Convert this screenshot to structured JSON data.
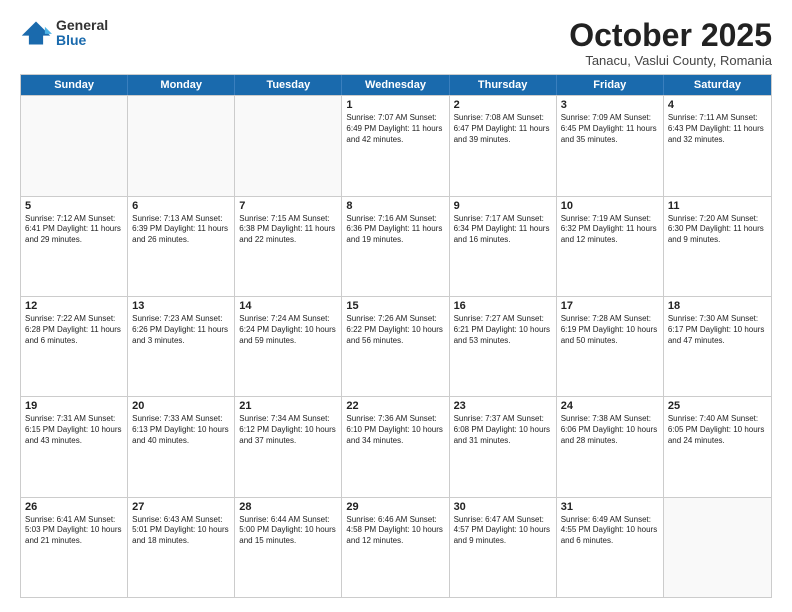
{
  "logo": {
    "general": "General",
    "blue": "Blue"
  },
  "title": "October 2025",
  "subtitle": "Tanacu, Vaslui County, Romania",
  "header_days": [
    "Sunday",
    "Monday",
    "Tuesday",
    "Wednesday",
    "Thursday",
    "Friday",
    "Saturday"
  ],
  "weeks": [
    [
      {
        "day": "",
        "info": "",
        "empty": true
      },
      {
        "day": "",
        "info": "",
        "empty": true
      },
      {
        "day": "",
        "info": "",
        "empty": true
      },
      {
        "day": "1",
        "info": "Sunrise: 7:07 AM\nSunset: 6:49 PM\nDaylight: 11 hours\nand 42 minutes."
      },
      {
        "day": "2",
        "info": "Sunrise: 7:08 AM\nSunset: 6:47 PM\nDaylight: 11 hours\nand 39 minutes."
      },
      {
        "day": "3",
        "info": "Sunrise: 7:09 AM\nSunset: 6:45 PM\nDaylight: 11 hours\nand 35 minutes."
      },
      {
        "day": "4",
        "info": "Sunrise: 7:11 AM\nSunset: 6:43 PM\nDaylight: 11 hours\nand 32 minutes."
      }
    ],
    [
      {
        "day": "5",
        "info": "Sunrise: 7:12 AM\nSunset: 6:41 PM\nDaylight: 11 hours\nand 29 minutes."
      },
      {
        "day": "6",
        "info": "Sunrise: 7:13 AM\nSunset: 6:39 PM\nDaylight: 11 hours\nand 26 minutes."
      },
      {
        "day": "7",
        "info": "Sunrise: 7:15 AM\nSunset: 6:38 PM\nDaylight: 11 hours\nand 22 minutes."
      },
      {
        "day": "8",
        "info": "Sunrise: 7:16 AM\nSunset: 6:36 PM\nDaylight: 11 hours\nand 19 minutes."
      },
      {
        "day": "9",
        "info": "Sunrise: 7:17 AM\nSunset: 6:34 PM\nDaylight: 11 hours\nand 16 minutes."
      },
      {
        "day": "10",
        "info": "Sunrise: 7:19 AM\nSunset: 6:32 PM\nDaylight: 11 hours\nand 12 minutes."
      },
      {
        "day": "11",
        "info": "Sunrise: 7:20 AM\nSunset: 6:30 PM\nDaylight: 11 hours\nand 9 minutes."
      }
    ],
    [
      {
        "day": "12",
        "info": "Sunrise: 7:22 AM\nSunset: 6:28 PM\nDaylight: 11 hours\nand 6 minutes."
      },
      {
        "day": "13",
        "info": "Sunrise: 7:23 AM\nSunset: 6:26 PM\nDaylight: 11 hours\nand 3 minutes."
      },
      {
        "day": "14",
        "info": "Sunrise: 7:24 AM\nSunset: 6:24 PM\nDaylight: 10 hours\nand 59 minutes."
      },
      {
        "day": "15",
        "info": "Sunrise: 7:26 AM\nSunset: 6:22 PM\nDaylight: 10 hours\nand 56 minutes."
      },
      {
        "day": "16",
        "info": "Sunrise: 7:27 AM\nSunset: 6:21 PM\nDaylight: 10 hours\nand 53 minutes."
      },
      {
        "day": "17",
        "info": "Sunrise: 7:28 AM\nSunset: 6:19 PM\nDaylight: 10 hours\nand 50 minutes."
      },
      {
        "day": "18",
        "info": "Sunrise: 7:30 AM\nSunset: 6:17 PM\nDaylight: 10 hours\nand 47 minutes."
      }
    ],
    [
      {
        "day": "19",
        "info": "Sunrise: 7:31 AM\nSunset: 6:15 PM\nDaylight: 10 hours\nand 43 minutes."
      },
      {
        "day": "20",
        "info": "Sunrise: 7:33 AM\nSunset: 6:13 PM\nDaylight: 10 hours\nand 40 minutes."
      },
      {
        "day": "21",
        "info": "Sunrise: 7:34 AM\nSunset: 6:12 PM\nDaylight: 10 hours\nand 37 minutes."
      },
      {
        "day": "22",
        "info": "Sunrise: 7:36 AM\nSunset: 6:10 PM\nDaylight: 10 hours\nand 34 minutes."
      },
      {
        "day": "23",
        "info": "Sunrise: 7:37 AM\nSunset: 6:08 PM\nDaylight: 10 hours\nand 31 minutes."
      },
      {
        "day": "24",
        "info": "Sunrise: 7:38 AM\nSunset: 6:06 PM\nDaylight: 10 hours\nand 28 minutes."
      },
      {
        "day": "25",
        "info": "Sunrise: 7:40 AM\nSunset: 6:05 PM\nDaylight: 10 hours\nand 24 minutes."
      }
    ],
    [
      {
        "day": "26",
        "info": "Sunrise: 6:41 AM\nSunset: 5:03 PM\nDaylight: 10 hours\nand 21 minutes."
      },
      {
        "day": "27",
        "info": "Sunrise: 6:43 AM\nSunset: 5:01 PM\nDaylight: 10 hours\nand 18 minutes."
      },
      {
        "day": "28",
        "info": "Sunrise: 6:44 AM\nSunset: 5:00 PM\nDaylight: 10 hours\nand 15 minutes."
      },
      {
        "day": "29",
        "info": "Sunrise: 6:46 AM\nSunset: 4:58 PM\nDaylight: 10 hours\nand 12 minutes."
      },
      {
        "day": "30",
        "info": "Sunrise: 6:47 AM\nSunset: 4:57 PM\nDaylight: 10 hours\nand 9 minutes."
      },
      {
        "day": "31",
        "info": "Sunrise: 6:49 AM\nSunset: 4:55 PM\nDaylight: 10 hours\nand 6 minutes."
      },
      {
        "day": "",
        "info": "",
        "empty": true
      }
    ]
  ]
}
